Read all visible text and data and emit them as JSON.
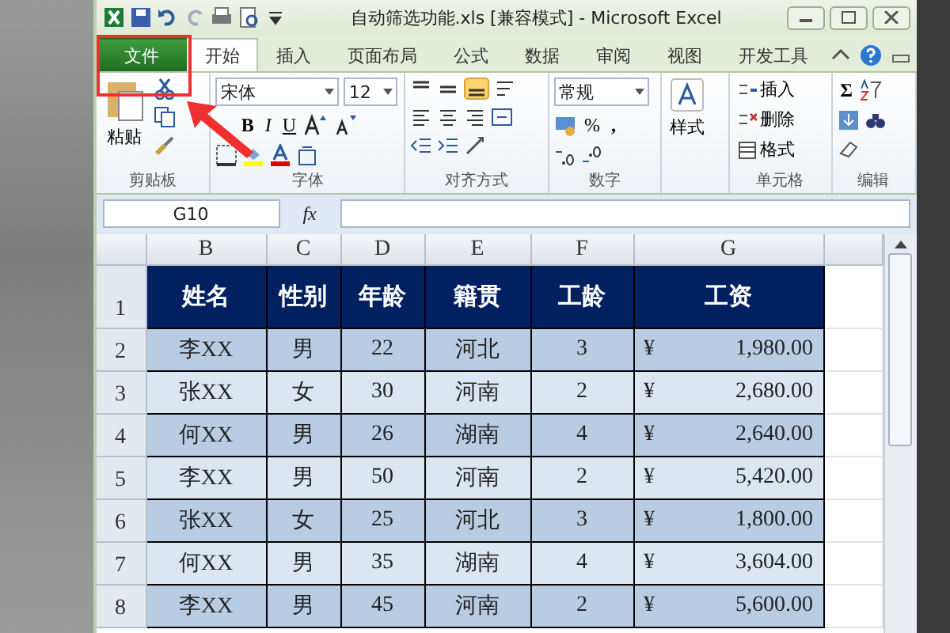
{
  "window": {
    "title": "自动筛选功能.xls  [兼容模式]  -  Microsoft Excel"
  },
  "tabs": [
    {
      "label": "文件",
      "kind": "file",
      "selected": false
    },
    {
      "label": "开始",
      "kind": "tab",
      "selected": true
    },
    {
      "label": "插入",
      "kind": "tab",
      "selected": false
    },
    {
      "label": "页面布局",
      "kind": "tab",
      "selected": false
    },
    {
      "label": "公式",
      "kind": "tab",
      "selected": false
    },
    {
      "label": "数据",
      "kind": "tab",
      "selected": false
    },
    {
      "label": "审阅",
      "kind": "tab",
      "selected": false
    },
    {
      "label": "视图",
      "kind": "tab",
      "selected": false
    },
    {
      "label": "开发工具",
      "kind": "tab",
      "selected": false
    }
  ],
  "ribbon": {
    "clipboard": {
      "label": "剪贴板",
      "paste": "粘贴"
    },
    "font": {
      "label": "字体",
      "name": "宋体",
      "size": "12",
      "bold": "B",
      "italic": "I",
      "underline": "U"
    },
    "alignment": {
      "label": "对齐方式"
    },
    "number": {
      "label": "数字",
      "format": "常规",
      "percent": "%",
      "comma": ","
    },
    "styles": {
      "button": "样式"
    },
    "cells": {
      "label": "单元格",
      "insert": "插入",
      "delete": "删除",
      "format": "格式"
    },
    "editing": {
      "label": "编辑",
      "sum": "Σ"
    }
  },
  "formula_bar": {
    "name_box": "G10",
    "fx": "fx"
  },
  "sheet": {
    "columns": [
      "B",
      "C",
      "D",
      "E",
      "F",
      "G"
    ],
    "header": {
      "number": "1",
      "cells": [
        "姓名",
        "性别",
        "年龄",
        "籍贯",
        "工龄",
        "工资"
      ]
    },
    "rows": [
      {
        "number": "2",
        "cells": [
          "李XX",
          "男",
          "22",
          "河北",
          "3"
        ],
        "currency": "¥",
        "amount": "1,980.00"
      },
      {
        "number": "3",
        "cells": [
          "张XX",
          "女",
          "30",
          "河南",
          "2"
        ],
        "currency": "¥",
        "amount": "2,680.00"
      },
      {
        "number": "4",
        "cells": [
          "何XX",
          "男",
          "26",
          "湖南",
          "4"
        ],
        "currency": "¥",
        "amount": "2,640.00"
      },
      {
        "number": "5",
        "cells": [
          "李XX",
          "男",
          "50",
          "河南",
          "2"
        ],
        "currency": "¥",
        "amount": "5,420.00"
      },
      {
        "number": "6",
        "cells": [
          "张XX",
          "女",
          "25",
          "河北",
          "3"
        ],
        "currency": "¥",
        "amount": "1,800.00"
      },
      {
        "number": "7",
        "cells": [
          "何XX",
          "男",
          "35",
          "湖南",
          "4"
        ],
        "currency": "¥",
        "amount": "3,604.00"
      },
      {
        "number": "8",
        "cells": [
          "李XX",
          "男",
          "45",
          "河南",
          "2"
        ],
        "currency": "¥",
        "amount": "5,600.00"
      }
    ]
  }
}
